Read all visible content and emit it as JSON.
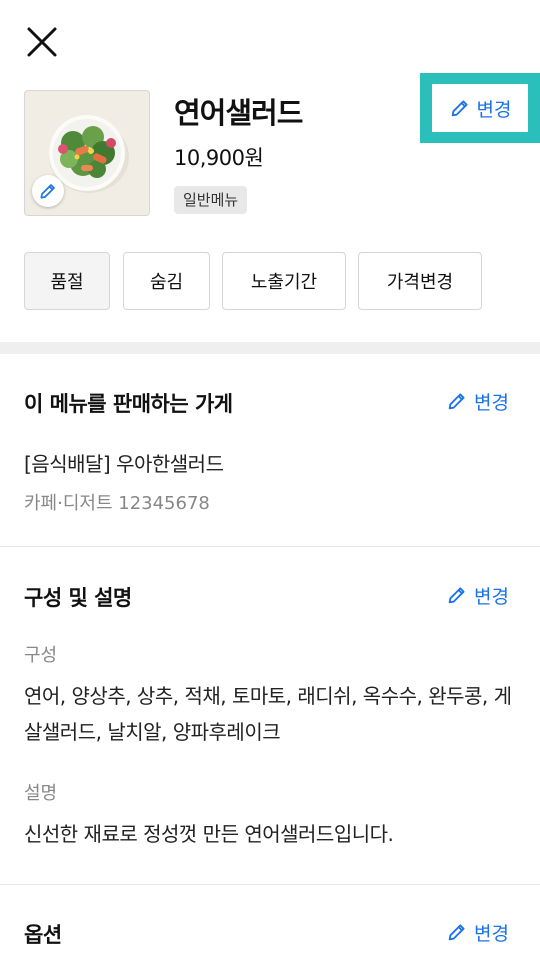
{
  "header": {
    "close_icon": "close-icon"
  },
  "menu": {
    "name": "연어샐러드",
    "price": "10,900원",
    "type_badge": "일반메뉴",
    "edit_label": "변경",
    "image_icon": "salad-bowl-image",
    "thumb_edit_icon": "pencil-icon"
  },
  "actions": [
    {
      "label": "품절",
      "active": true
    },
    {
      "label": "숨김",
      "active": false
    },
    {
      "label": "노출기간",
      "active": false
    },
    {
      "label": "가격변경",
      "active": false
    }
  ],
  "stores": {
    "title": "이 메뉴를 판매하는 가게",
    "edit_label": "변경",
    "store_name": "[음식배달] 우아한샐러드",
    "store_info": "카페·디저트 12345678"
  },
  "composition": {
    "title": "구성 및 설명",
    "edit_label": "변경",
    "composition_label": "구성",
    "composition_text": "연어, 양상추, 상추, 적채, 토마토, 래디쉬, 옥수수, 완두콩, 게살샐러드, 날치알, 양파후레이크",
    "description_label": "설명",
    "description_text": "신선한 재료로 정성껏 만든 연어샐러드입니다."
  },
  "options": {
    "title": "옵션",
    "edit_label": "변경"
  },
  "colors": {
    "accent": "#1a73e8",
    "highlight": "#2bbfbc"
  }
}
